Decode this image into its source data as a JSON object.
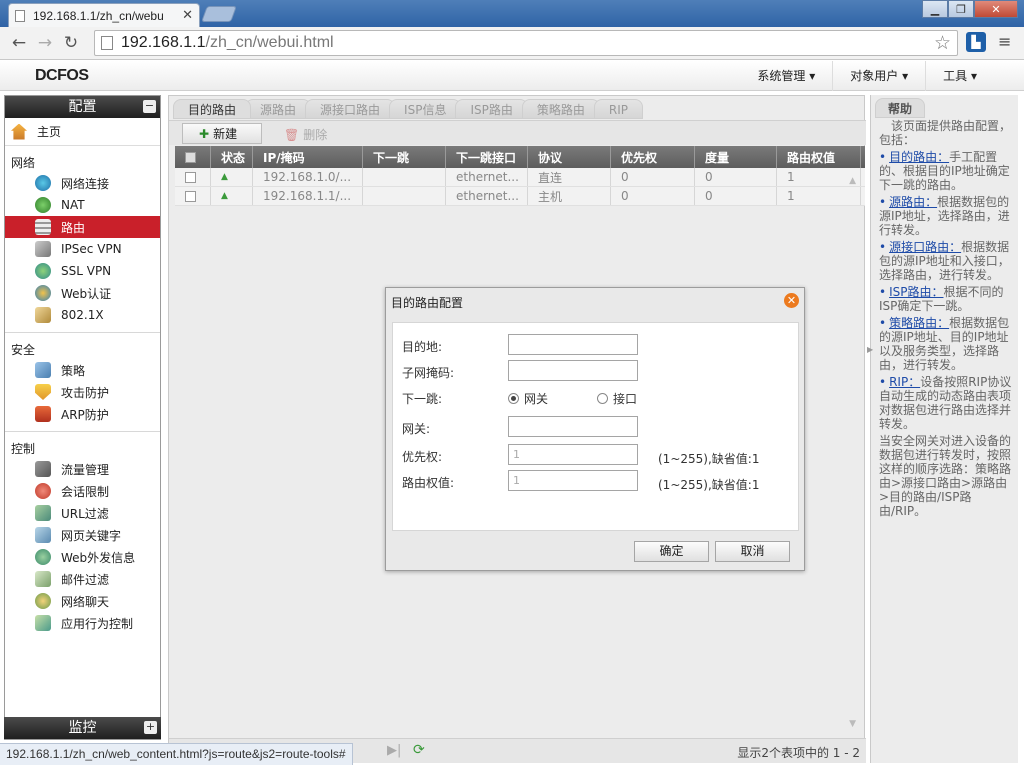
{
  "browser": {
    "tab_title": "192.168.1.1/zh_cn/webu",
    "url_host": "192.168.1.1",
    "url_path": "/zh_cn/webui.html"
  },
  "header": {
    "logo": "DCFOS",
    "menu": [
      "系统管理",
      "对象用户",
      "工具"
    ]
  },
  "sidebar": {
    "title": "配置",
    "toggle": "−",
    "home": "主页",
    "sections": [
      {
        "label": "网络",
        "items": [
          "网络连接",
          "NAT",
          "路由",
          "IPSec VPN",
          "SSL VPN",
          "Web认证",
          "802.1X"
        ]
      },
      {
        "label": "安全",
        "items": [
          "策略",
          "攻击防护",
          "ARP防护"
        ]
      },
      {
        "label": "控制",
        "items": [
          "流量管理",
          "会话限制",
          "URL过滤",
          "网页关键字",
          "Web外发信息",
          "邮件过滤",
          "网络聊天",
          "应用行为控制"
        ]
      }
    ],
    "active_item": "路由",
    "monitor": "监控",
    "monitor_toggle": "+"
  },
  "main": {
    "tabs": [
      "目的路由",
      "源路由",
      "源接口路由",
      "ISP信息",
      "ISP路由",
      "策略路由",
      "RIP"
    ],
    "active_tab": "目的路由",
    "toolbar": {
      "new": "新建",
      "delete": "删除"
    },
    "columns": [
      "状态",
      "IP/掩码",
      "下一跳",
      "下一跳接口",
      "协议",
      "优先权",
      "度量",
      "路由权值"
    ],
    "rows": [
      {
        "ip": "192.168.1.0/...",
        "next_hop": "",
        "iface": "ethernet...",
        "protocol": "直连",
        "priority": "0",
        "metric": "0",
        "weight": "1"
      },
      {
        "ip": "192.168.1.1/...",
        "next_hop": "",
        "iface": "ethernet...",
        "protocol": "主机",
        "priority": "0",
        "metric": "0",
        "weight": "1"
      }
    ],
    "pager_info": "显示2个表项中的 1 - 2"
  },
  "help": {
    "title": "帮助",
    "intro": "该页面提供路由配置，包括：",
    "items": [
      {
        "link": "目的路由：",
        "text": "手工配置的、根据目的IP地址确定下一跳的路由。"
      },
      {
        "link": "源路由：",
        "text": "根据数据包的源IP地址，选择路由，进行转发。"
      },
      {
        "link": "源接口路由：",
        "text": "根据数据包的源IP地址和入接口，选择路由，进行转发。"
      },
      {
        "link": "ISP路由：",
        "text": "根据不同的ISP确定下一跳。"
      },
      {
        "link": "策略路由：",
        "text": "根据数据包的源IP地址、目的IP地址以及服务类型，选择路由，进行转发。"
      },
      {
        "link": "RIP：",
        "text": "设备按照RIP协议自动生成的动态路由表项对数据包进行路由选择并转发。"
      }
    ],
    "footer": "当安全网关对进入设备的数据包进行转发时，按照这样的顺序选路：策略路由>源接口路由>源路由>目的路由/ISP路由/RIP。"
  },
  "dialog": {
    "title": "目的路由配置",
    "fields": {
      "dest_label": "目的地:",
      "mask_label": "子网掩码:",
      "nexthop_label": "下一跳:",
      "radio_gateway": "网关",
      "radio_iface": "接口",
      "gateway_label": "网关:",
      "priority_label": "优先权:",
      "priority_value": "1",
      "priority_hint": "(1~255),缺省值:1",
      "weight_label": "路由权值:",
      "weight_value": "1",
      "weight_hint": "(1~255),缺省值:1"
    },
    "ok": "确定",
    "cancel": "取消"
  },
  "statusbar": "192.168.1.1/zh_cn/web_content.html?js=route&js2=route-tools#"
}
